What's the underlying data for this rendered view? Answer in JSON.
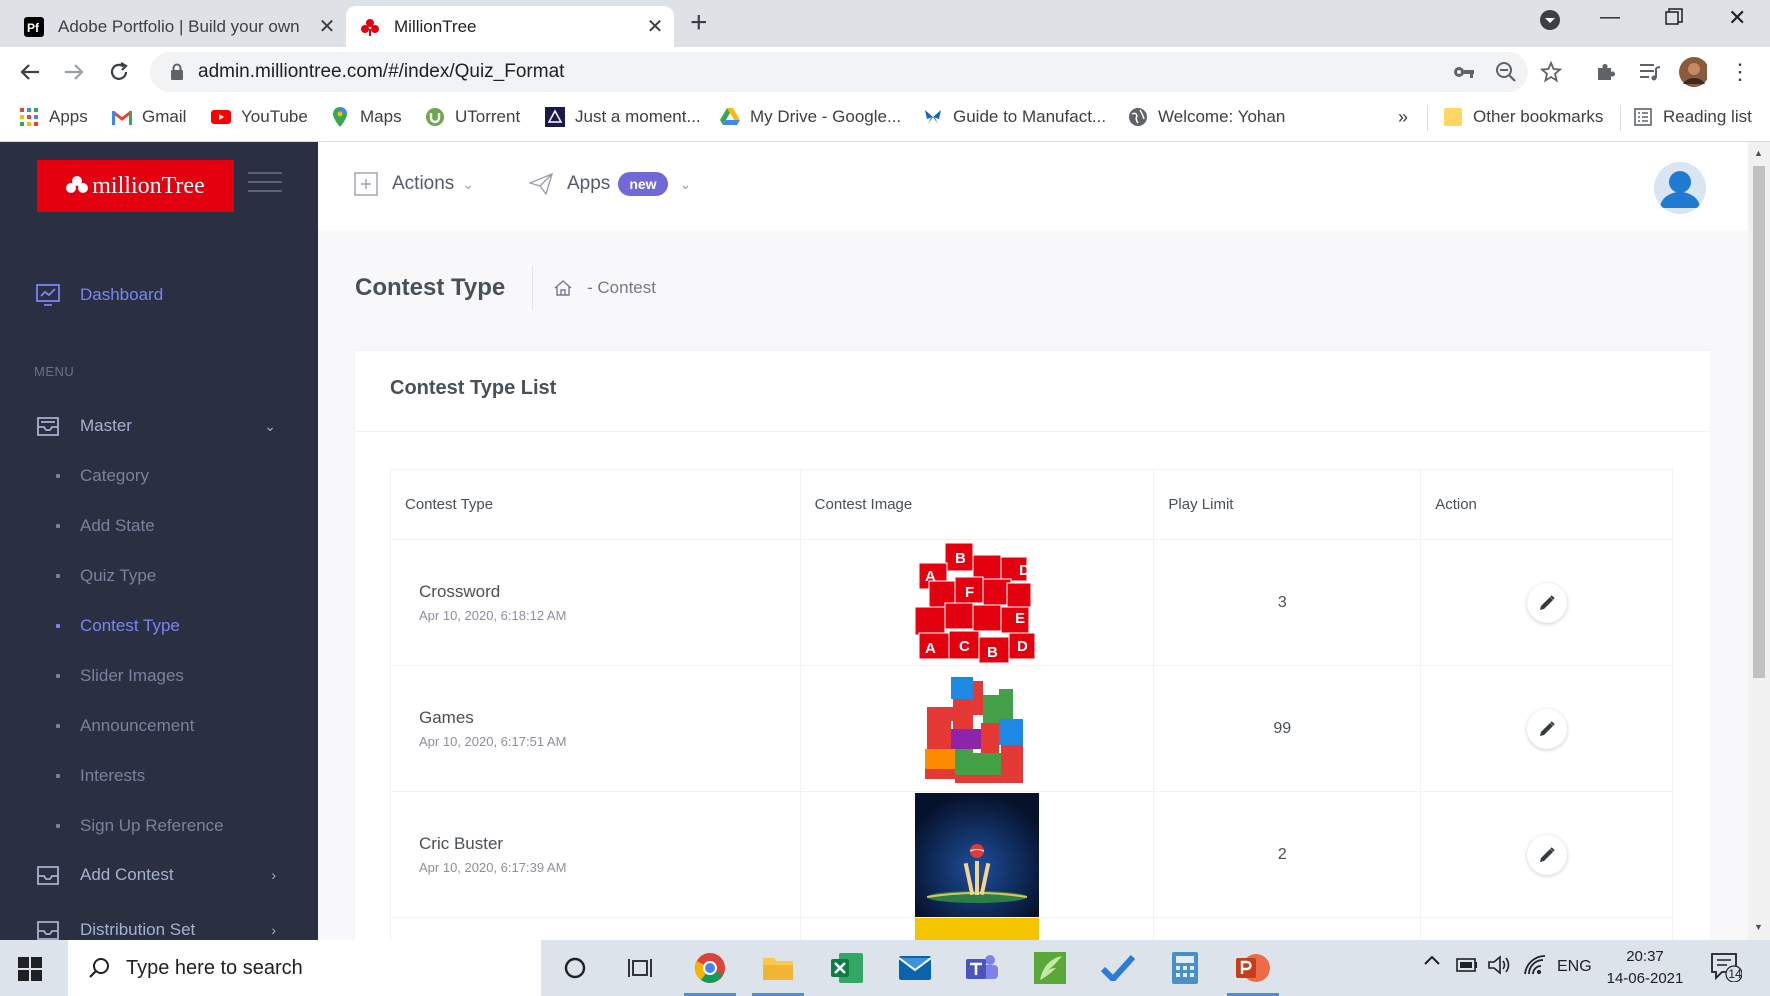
{
  "browser": {
    "tabs": [
      {
        "title": "Adobe Portfolio | Build your own",
        "active": false
      },
      {
        "title": "MillionTree",
        "active": true
      }
    ],
    "url": "admin.milliontree.com/#/index/Quiz_Format",
    "bookmarks": [
      {
        "label": "Apps",
        "icon": "apps-grid-icon"
      },
      {
        "label": "Gmail",
        "icon": "gmail-icon"
      },
      {
        "label": "YouTube",
        "icon": "youtube-icon"
      },
      {
        "label": "Maps",
        "icon": "maps-pin-icon"
      },
      {
        "label": "UTorrent",
        "icon": "utorrent-icon"
      },
      {
        "label": "Just a moment...",
        "icon": "site-icon"
      },
      {
        "label": "My Drive - Google...",
        "icon": "google-drive-icon"
      },
      {
        "label": "Guide to Manufact...",
        "icon": "butterfly-icon"
      },
      {
        "label": "Welcome: Yohan",
        "icon": "globe-icon"
      }
    ],
    "other_bookmarks": "Other bookmarks",
    "reading_list": "Reading list",
    "overflow": "»"
  },
  "sidebar": {
    "logo_text": "millionTree",
    "dashboard": "Dashboard",
    "menu_label": "MENU",
    "master": "Master",
    "sub_items": [
      {
        "label": "Category",
        "active": false
      },
      {
        "label": "Add State",
        "active": false
      },
      {
        "label": "Quiz Type",
        "active": false
      },
      {
        "label": "Contest Type",
        "active": true
      },
      {
        "label": "Slider Images",
        "active": false
      },
      {
        "label": "Announcement",
        "active": false
      },
      {
        "label": "Interests",
        "active": false
      },
      {
        "label": "Sign Up Reference",
        "active": false
      }
    ],
    "add_contest": "Add Contest",
    "distribution_set": "Distribution Set"
  },
  "topbar": {
    "actions": "Actions",
    "apps": "Apps",
    "apps_badge": "new"
  },
  "page": {
    "title": "Contest Type",
    "breadcrumb": "- Contest"
  },
  "card": {
    "title": "Contest Type List",
    "columns": [
      "Contest Type",
      "Contest Image",
      "Play Limit",
      "Action"
    ],
    "rows": [
      {
        "name": "Crossword",
        "date": "Apr 10, 2020, 6:18:12 AM",
        "limit": "3",
        "image": "crossword"
      },
      {
        "name": "Games",
        "date": "Apr 10, 2020, 6:17:51 AM",
        "limit": "99",
        "image": "games"
      },
      {
        "name": "Cric Buster",
        "date": "Apr 10, 2020, 6:17:39 AM",
        "limit": "2",
        "image": "cricket"
      }
    ]
  },
  "taskbar": {
    "search_placeholder": "Type here to search",
    "language": "ENG",
    "time": "20:37",
    "date": "14-06-2021",
    "notifications": "14"
  }
}
